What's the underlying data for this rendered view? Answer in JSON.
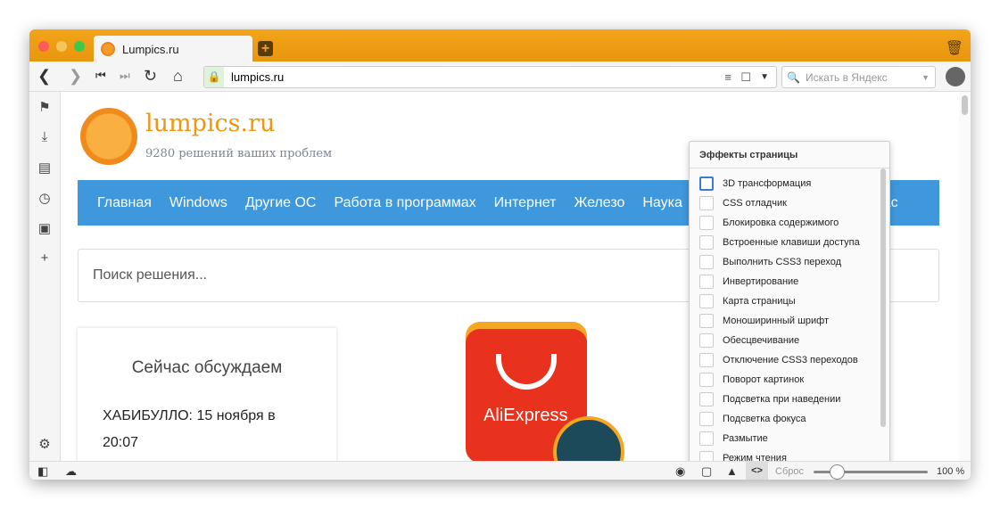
{
  "tab": {
    "title": "Lumpics.ru"
  },
  "toolbar": {
    "url": "lumpics.ru",
    "search_placeholder": "Искать в Яндекс"
  },
  "page": {
    "brand": "lumpics.ru",
    "tagline": "9280 решений ваших проблем",
    "nav": [
      "Главная",
      "Windows",
      "Другие ОС",
      "Работа в программах",
      "Интернет",
      "Железо",
      "Наука",
      "О нас"
    ],
    "search_placeholder": "Поиск решения...",
    "card_title": "Сейчас обсуждаем",
    "card_text": "ХАБИБУЛЛО: 15 ноября в 20:07",
    "ad_label": "AliExpress"
  },
  "popup": {
    "title": "Эффекты страницы",
    "items": [
      "3D трансформация",
      "CSS отладчик",
      "Блокировка содержимого",
      "Встроенные клавиши доступа",
      "Выполнить CSS3 переход",
      "Инвертирование",
      "Карта страницы",
      "Моноширинный шрифт",
      "Обесцвечивание",
      "Отключение CSS3 переходов",
      "Поворот картинок",
      "Подсветка при наведении",
      "Подсветка фокуса",
      "Размытие",
      "Режим чтения"
    ]
  },
  "status": {
    "reset": "Сброс",
    "zoom": "100 %",
    "zoom_slider_fraction": 0.2
  }
}
